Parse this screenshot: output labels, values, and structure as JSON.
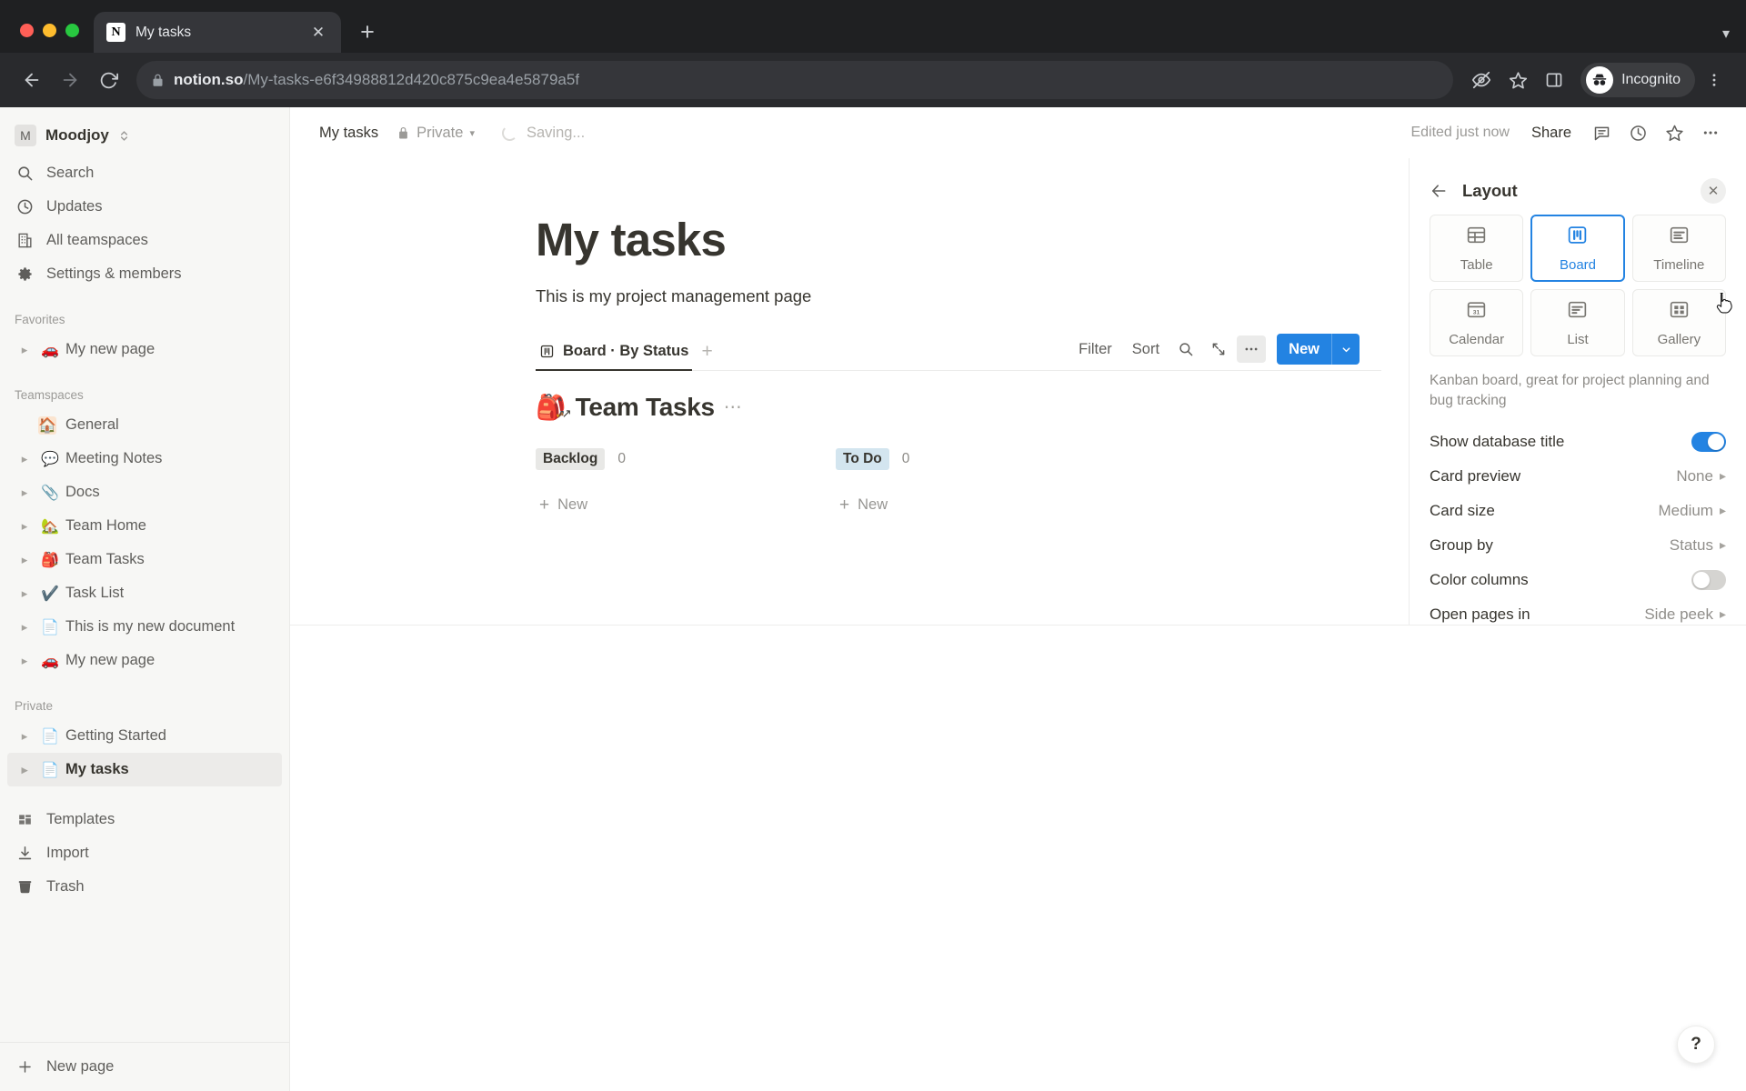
{
  "browser": {
    "tab": {
      "title": "My tasks",
      "favicon_letter": "N",
      "close_icon": "close-icon"
    },
    "new_tab_label": "+",
    "tabstrip_menu_icon": "chevron-down-icon",
    "url": {
      "host": "notion.so",
      "path": "/My-tasks-e6f34988812d420c875c9ea4e5879a5f"
    },
    "profile": {
      "label": "Incognito"
    },
    "icons": [
      "back-icon",
      "forward-icon",
      "reload-icon",
      "lock-icon",
      "tracking-protection-icon",
      "bookmark-star-icon",
      "side-panel-icon",
      "incognito-icon",
      "chrome-menu-icon"
    ]
  },
  "sidebar": {
    "workspace": {
      "name": "Moodjoy",
      "avatar_letter": "M"
    },
    "nav": [
      {
        "label": "Search",
        "icon": "search-icon"
      },
      {
        "label": "Updates",
        "icon": "clock-icon"
      },
      {
        "label": "All teamspaces",
        "icon": "building-icon"
      },
      {
        "label": "Settings & members",
        "icon": "gear-icon"
      }
    ],
    "favorites_label": "Favorites",
    "favorites": [
      {
        "label": "My new page",
        "emoji": "🚗"
      }
    ],
    "teamspaces_label": "Teamspaces",
    "teamspaces": [
      {
        "label": "General",
        "emoji": "🏠",
        "tinted": true,
        "no_disclosure": true
      },
      {
        "label": "Meeting Notes",
        "emoji": "💬"
      },
      {
        "label": "Docs",
        "emoji": "📎"
      },
      {
        "label": "Team Home",
        "emoji": "🏡"
      },
      {
        "label": "Team Tasks",
        "emoji": "🎒"
      },
      {
        "label": "Task List",
        "emoji": "✔️"
      },
      {
        "label": "This is my new document",
        "emoji": "📄"
      },
      {
        "label": "My new page",
        "emoji": "🚗"
      }
    ],
    "private_label": "Private",
    "private": [
      {
        "label": "Getting Started",
        "emoji": "📄",
        "active": false
      },
      {
        "label": "My tasks",
        "emoji": "📄",
        "active": true
      }
    ],
    "utilities": [
      {
        "label": "Templates",
        "icon": "templates-icon"
      },
      {
        "label": "Import",
        "icon": "import-icon"
      },
      {
        "label": "Trash",
        "icon": "trash-icon"
      }
    ],
    "new_page_label": "New page"
  },
  "topbar": {
    "breadcrumb": "My tasks",
    "privacy_label": "Private",
    "privacy_icon": "lock-icon",
    "saving_label": "Saving...",
    "edited_label": "Edited just now",
    "share_label": "Share",
    "icons": [
      "comment-icon",
      "history-icon",
      "star-icon",
      "more-icon"
    ]
  },
  "page": {
    "title": "My tasks",
    "description": "This is my project management page",
    "view_tab": {
      "label": "Board · By Status",
      "icon": "board-icon"
    },
    "add_view_label": "+",
    "toolbar": {
      "filter_label": "Filter",
      "sort_label": "Sort",
      "search_icon": "search-icon",
      "expand_icon": "expand-icon",
      "more_icon": "more-icon",
      "new_label": "New",
      "new_caret_icon": "chevron-down-icon"
    }
  },
  "board": {
    "emoji": "🎒",
    "title": "Team Tasks",
    "more_icon": "more-icon",
    "columns": [
      {
        "name": "Backlog",
        "count": "0",
        "color": "gray",
        "new_label": "New"
      },
      {
        "name": "To Do",
        "count": "0",
        "color": "blue",
        "new_label": "New"
      }
    ]
  },
  "layout_panel": {
    "back_icon": "arrow-left-icon",
    "title": "Layout",
    "close_icon": "close-icon",
    "tiles": [
      {
        "label": "Table",
        "icon": "table-icon",
        "selected": false
      },
      {
        "label": "Board",
        "icon": "board-icon",
        "selected": true
      },
      {
        "label": "Timeline",
        "icon": "timeline-icon",
        "selected": false
      },
      {
        "label": "Calendar",
        "icon": "calendar-icon",
        "selected": false
      },
      {
        "label": "List",
        "icon": "list-icon",
        "selected": false
      },
      {
        "label": "Gallery",
        "icon": "gallery-icon",
        "selected": false
      }
    ],
    "description": "Kanban board, great for project planning and bug tracking",
    "options": [
      {
        "label": "Show database title",
        "type": "toggle",
        "value": "on"
      },
      {
        "label": "Card preview",
        "type": "select",
        "value": "None"
      },
      {
        "label": "Card size",
        "type": "select",
        "value": "Medium"
      },
      {
        "label": "Group by",
        "type": "select",
        "value": "Status"
      },
      {
        "label": "Color columns",
        "type": "toggle",
        "value": "off"
      },
      {
        "label": "Open pages in",
        "type": "select",
        "value": "Side peek"
      }
    ]
  },
  "help": {
    "label": "?"
  },
  "colors": {
    "accent": "#2383e2",
    "text": "#37352f",
    "muted": "#9b9a97",
    "sidebar_bg": "#f7f7f5"
  }
}
